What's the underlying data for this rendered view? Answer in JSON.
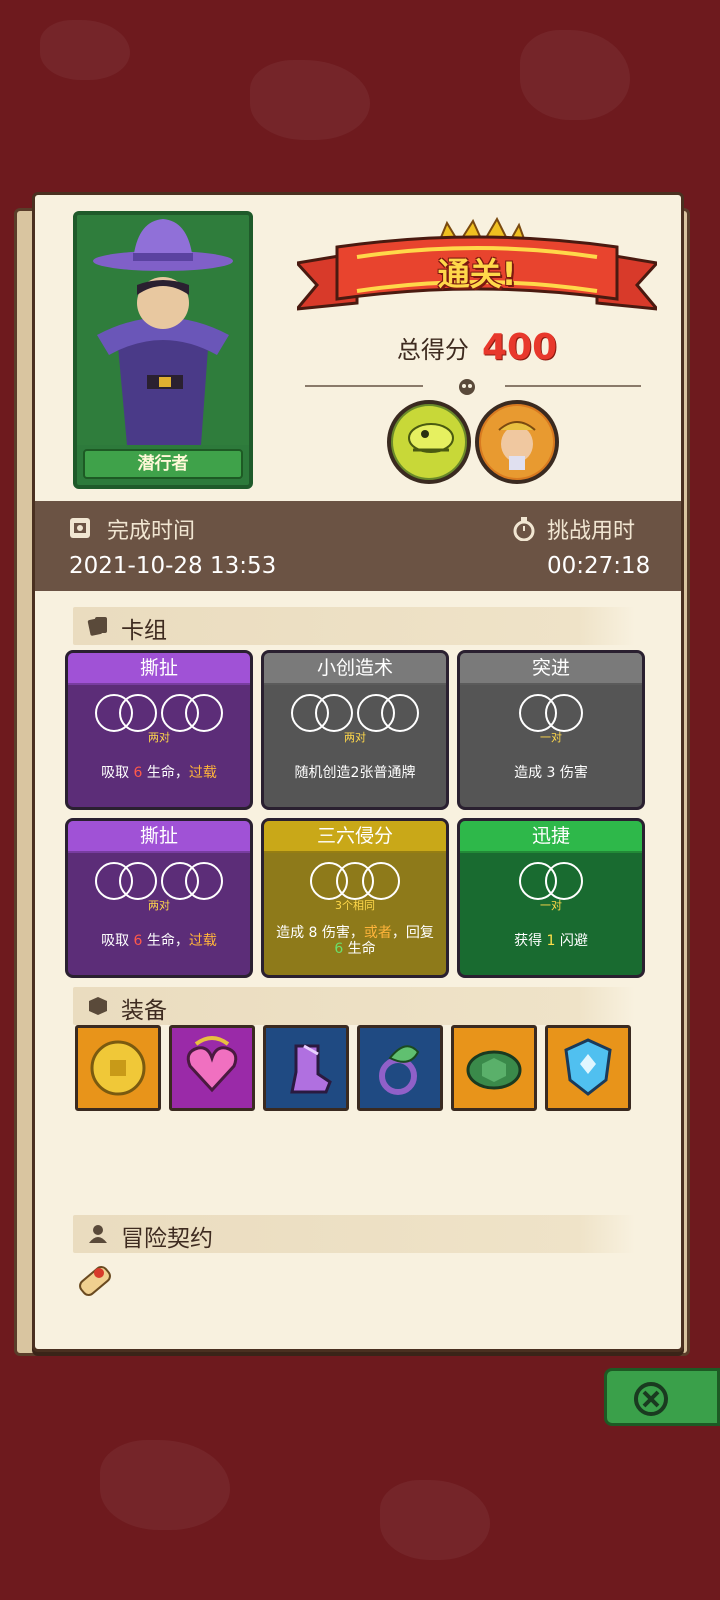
{
  "hero": {
    "name": "潜行者"
  },
  "result": {
    "banner": "通关!",
    "score_label": "总得分",
    "score_value": "400"
  },
  "stats": {
    "finish_time_label": "完成时间",
    "finish_time_value": "2021-10-28 13:53",
    "challenge_time_label": "挑战用时",
    "challenge_time_value": "00:27:18"
  },
  "deck": {
    "title": "卡组",
    "cards": [
      {
        "name": "撕扯",
        "color": "purple",
        "condition": "两对",
        "desc_parts": [
          "吸取 ",
          "6",
          " 生命，",
          "过载"
        ]
      },
      {
        "name": "小创造术",
        "color": "gray",
        "condition": "两对",
        "desc": "随机创造2张普通牌"
      },
      {
        "name": "突进",
        "color": "gray",
        "condition": "一对",
        "desc": "造成 3 伤害"
      },
      {
        "name": "撕扯",
        "color": "purple",
        "condition": "两对",
        "desc_parts": [
          "吸取 ",
          "6",
          " 生命，",
          "过载"
        ]
      },
      {
        "name": "三六侵分",
        "color": "olive",
        "condition": "3个相同",
        "desc_parts": [
          "造成 ",
          "8 伤害，",
          "或者",
          "，回复 ",
          "6",
          " 生命"
        ]
      },
      {
        "name": "迅捷",
        "color": "green",
        "condition": "一对",
        "desc_parts": [
          "获得 ",
          "1",
          " 闪避"
        ]
      }
    ]
  },
  "equipment": {
    "title": "装备",
    "items": [
      {
        "icon": "gold-coin-icon",
        "bg": "#e8941a"
      },
      {
        "icon": "heart-necklace-icon",
        "bg": "#9a2aa8"
      },
      {
        "icon": "crystal-boot-icon",
        "bg": "#1f4a82"
      },
      {
        "icon": "leaf-ring-icon",
        "bg": "#1f4a82"
      },
      {
        "icon": "turtle-shell-icon",
        "bg": "#e8941a"
      },
      {
        "icon": "blue-shield-icon",
        "bg": "#e8941a"
      }
    ]
  },
  "contract": {
    "title": "冒险契约"
  }
}
